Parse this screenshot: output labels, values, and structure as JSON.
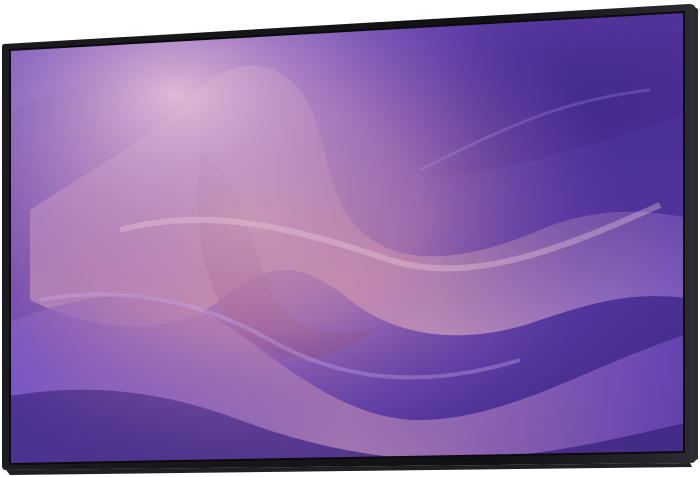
{
  "product": {
    "kind": "display-monitor",
    "view": "three-quarter-left",
    "colors": {
      "bezel": "#121216",
      "background": "#ffffff",
      "screen_deep": "#4a2b8f",
      "screen_mid": "#7a52c8",
      "screen_warm": "#d49a9f",
      "screen_light": "#e7c6d9"
    },
    "screen": {
      "content": "abstract-purple-waves",
      "tone": "violet-magenta-peach"
    }
  }
}
